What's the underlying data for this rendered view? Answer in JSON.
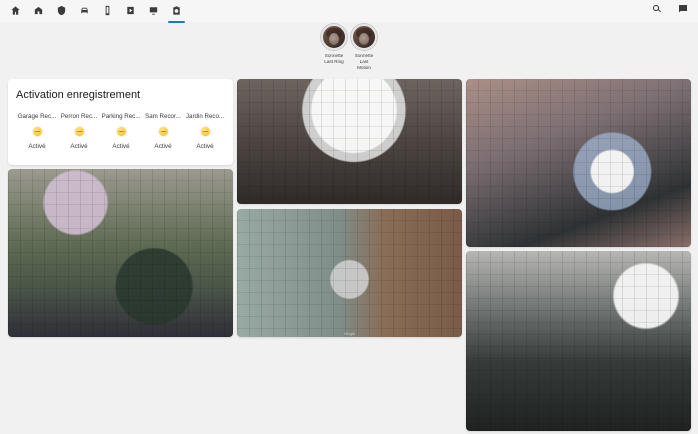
{
  "top_nav": {
    "tabs": [
      {
        "name": "home-icon",
        "active": false
      },
      {
        "name": "house-icon",
        "active": false
      },
      {
        "name": "shield-icon",
        "active": false
      },
      {
        "name": "car-icon",
        "active": false
      },
      {
        "name": "phone-icon",
        "active": false
      },
      {
        "name": "play-icon",
        "active": false
      },
      {
        "name": "monitor-icon",
        "active": false
      },
      {
        "name": "camera-icon",
        "active": true
      }
    ],
    "actions": [
      {
        "name": "search-icon"
      },
      {
        "name": "message-icon"
      }
    ],
    "accent_color": "#1a73e8"
  },
  "people": [
    {
      "label": "Sonnette\nLast Ring"
    },
    {
      "label": "Sonnette\nLast\nMotion"
    }
  ],
  "activation_card": {
    "title": "Activation enregistrement",
    "items": [
      {
        "name": "Garage Rec...",
        "state": "Activé"
      },
      {
        "name": "Perron Rec...",
        "state": "Activé"
      },
      {
        "name": "Parking Rec...",
        "state": "Activé"
      },
      {
        "name": "Sam Recor...",
        "state": "Activé"
      },
      {
        "name": "Jardin Reco...",
        "state": "Activé"
      }
    ]
  },
  "camera_tiles": [
    {
      "watermark": ""
    },
    {
      "watermark": ""
    },
    {
      "watermark": ""
    },
    {
      "watermark": "Single"
    },
    {
      "watermark": ""
    }
  ]
}
